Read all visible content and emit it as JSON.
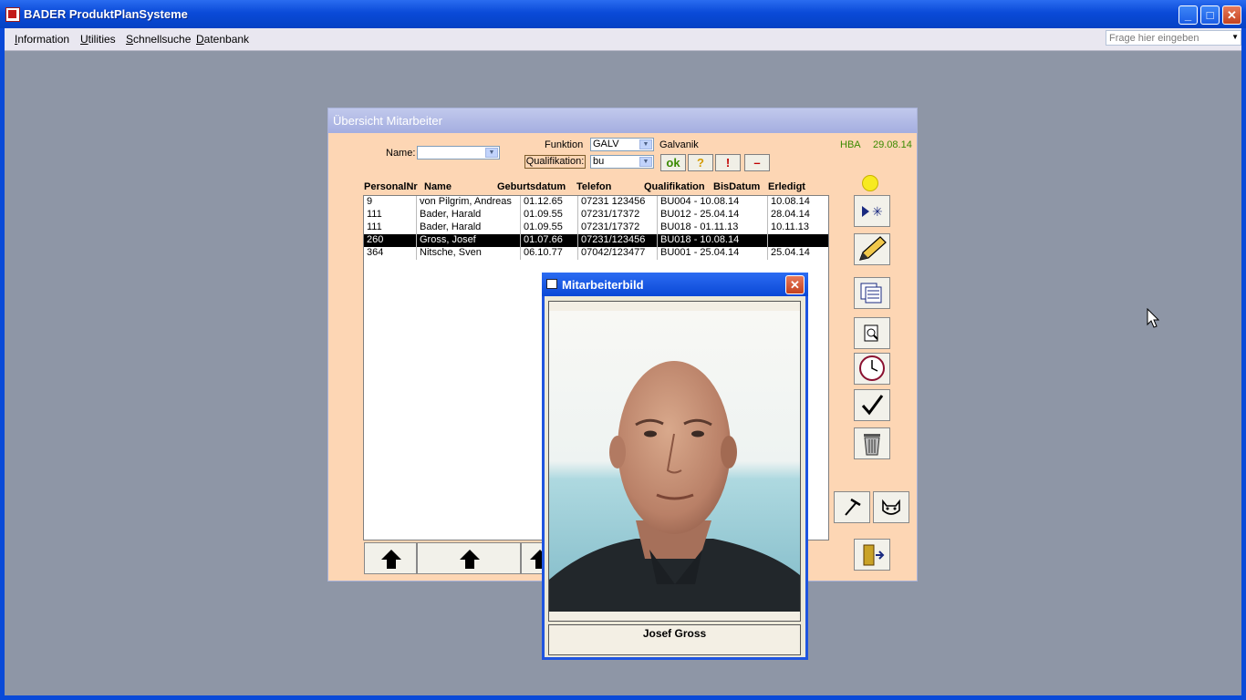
{
  "app": {
    "title": "BADER ProduktPlanSysteme",
    "controls": {
      "minimize": "_",
      "maximize": "□",
      "close": "✕"
    }
  },
  "menu": {
    "items": [
      "Information",
      "Utilities",
      "Schnellsuche",
      "Datenbank"
    ],
    "help_placeholder": "Frage hier eingeben"
  },
  "overview": {
    "title": "Übersicht Mitarbeiter",
    "name_label": "Name:",
    "name_value": "",
    "funktion_label": "Funktion",
    "funktion_value": "GALV",
    "funktion_desc": "Galvanik",
    "qualifikation_label": "Qualifikation:",
    "qualifikation_value": "bu",
    "user": "HBA",
    "date": "29.08.14",
    "filter_buttons": [
      "ok",
      "?",
      "!",
      "–"
    ],
    "columns": [
      "PersonalNr",
      "Name",
      "Geburtsdatum",
      "Telefon",
      "Qualifikation",
      "BisDatum",
      "Erledigt"
    ],
    "rows": [
      [
        "9",
        "von Pilgrim, Andreas",
        "01.12.65",
        "07231 123456",
        "BU004 - 10.08.14",
        "10.08.14"
      ],
      [
        "111",
        "Bader, Harald",
        "01.09.55",
        "07231/17372",
        "BU012 - 25.04.14",
        "28.04.14"
      ],
      [
        "111",
        "Bader, Harald",
        "01.09.55",
        "07231/17372",
        "BU018 - 01.11.13",
        "10.11.13"
      ],
      [
        "260",
        "Gross, Josef",
        "01.07.66",
        "07231/123456",
        "BU018 - 10.08.14",
        ""
      ],
      [
        "364",
        "Nitsche, Sven",
        "06.10.77",
        "07042/123477",
        "BU001 - 25.04.14",
        "25.04.14"
      ]
    ],
    "selected_row": 3,
    "side_icons": [
      "smiley-icon",
      "new-record-icon",
      "pencil-icon",
      "copy-icon",
      "preview-icon",
      "clock-icon",
      "check-icon",
      "trash-icon",
      "pick-icon",
      "mask-icon",
      "exit-door-icon"
    ]
  },
  "popup": {
    "title": "Mitarbeiterbild",
    "caption": "Josef Gross"
  },
  "colors": {
    "xp_blue": "#0a4ad8",
    "form_bg": "#fdd6b4",
    "desktop": "#8e96a6"
  }
}
